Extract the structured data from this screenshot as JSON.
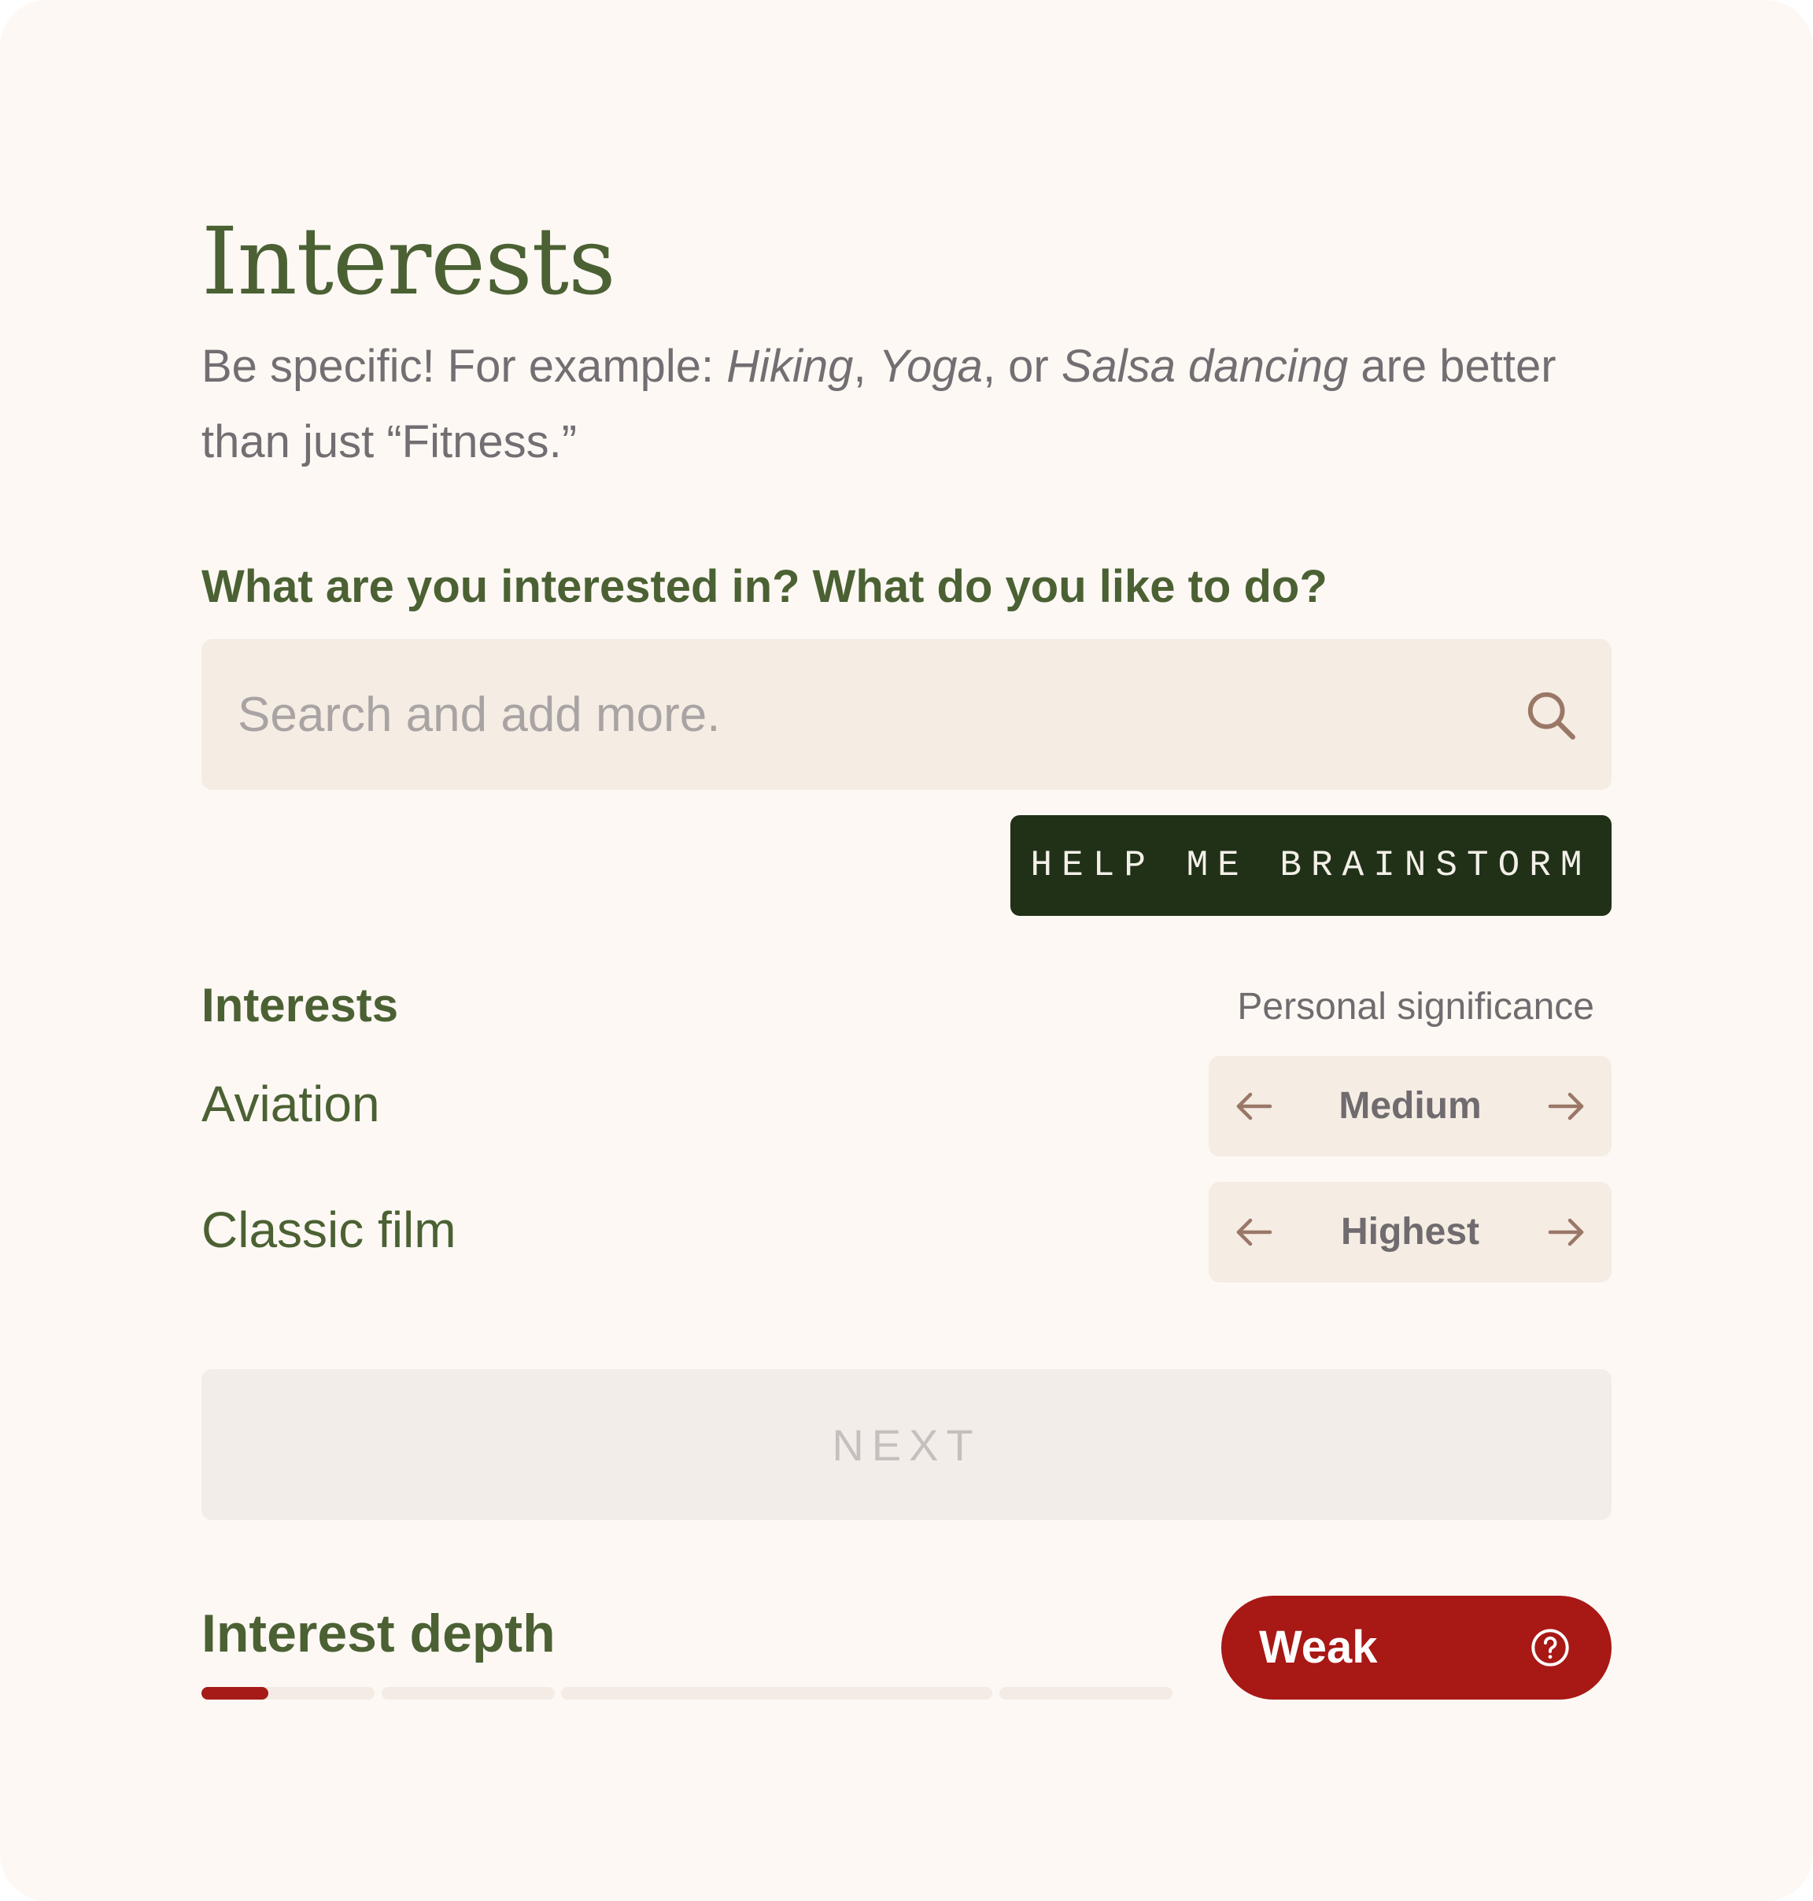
{
  "page": {
    "title": "Interests",
    "subtitle": {
      "prefix": "Be specific! For example: ",
      "example_1": "Hiking",
      "sep_1": ", ",
      "example_2": "Yoga",
      "sep_2": ", or ",
      "example_3": "Salsa dancing",
      "suffix": " are better than just “Fitness.”"
    },
    "question": "What are you interested in? What do you like to do?"
  },
  "search": {
    "placeholder": "Search and add more.",
    "value": "",
    "icon": "search-icon"
  },
  "brainstorm_button": {
    "label": "HELP ME BRAINSTORM"
  },
  "interests": {
    "heading": "Interests",
    "significance_heading": "Personal significance",
    "items": [
      {
        "label": "Aviation",
        "significance": "Medium"
      },
      {
        "label": "Classic film",
        "significance": "Highest"
      }
    ]
  },
  "next_button": {
    "label": "NEXT",
    "enabled": false
  },
  "depth": {
    "label": "Interest depth",
    "progress": 0.07,
    "segments": 5,
    "rating": "Weak",
    "rating_icon": "help-circle-icon"
  },
  "colors": {
    "background": "#fdf8f4",
    "heading_green": "#4b6133",
    "body_gray": "#726e72",
    "input_bg": "#f5ece3",
    "brainstorm_bg": "#203118",
    "weak_red": "#a81815",
    "icon_brown": "#9a7767"
  }
}
